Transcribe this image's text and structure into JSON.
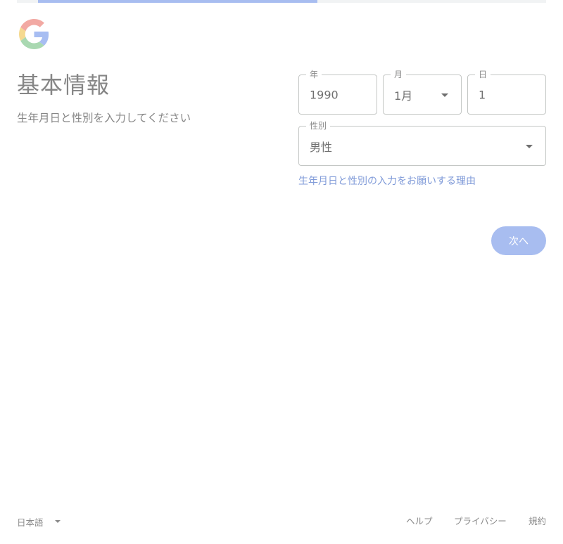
{
  "header": {
    "logo_icon": "google-g-logo-icon",
    "progress_fraction": 0.55
  },
  "main": {
    "title": "基本情報",
    "subtitle": "生年月日と性別を入力してください"
  },
  "form": {
    "year": {
      "label": "年",
      "value": "1990"
    },
    "month": {
      "label": "月",
      "value": "1月",
      "icon": "dropdown-arrow-icon"
    },
    "day": {
      "label": "日",
      "value": "1"
    },
    "gender": {
      "label": "性別",
      "value": "男性",
      "icon": "dropdown-arrow-icon"
    },
    "why_link": "生年月日と性別の入力をお願いする理由",
    "next_label": "次へ"
  },
  "footer": {
    "language": "日本語",
    "help": "ヘルプ",
    "privacy": "プライバシー",
    "terms": "規約"
  },
  "colors": {
    "accent": "#a8bdf0",
    "link": "#7f9ad8",
    "text_muted": "#868686",
    "border": "#c4c7c5"
  }
}
